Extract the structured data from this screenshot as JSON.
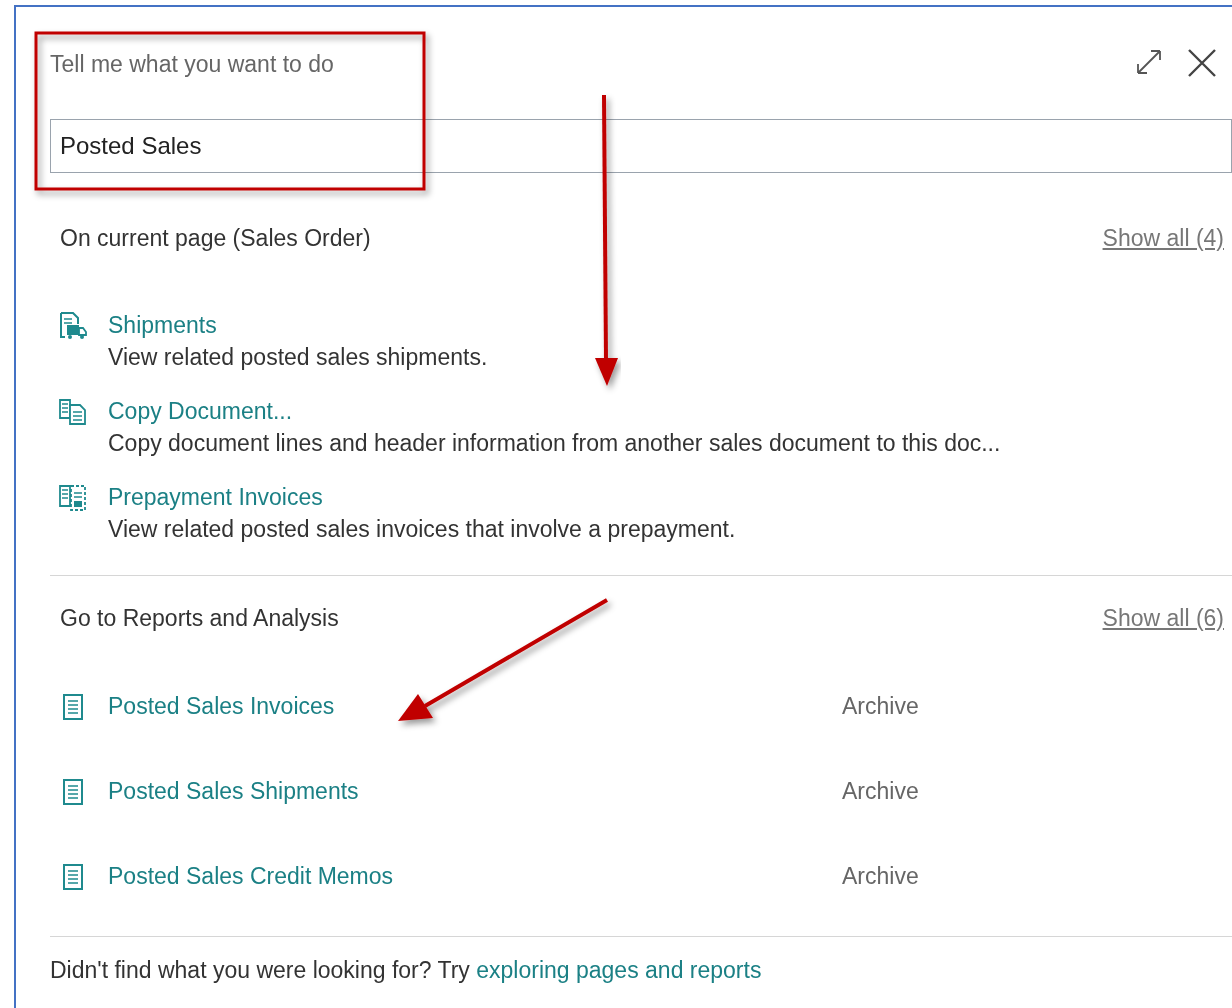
{
  "search": {
    "label": "Tell me what you want to do",
    "value": "Posted Sales"
  },
  "sections": [
    {
      "title": "On current page (Sales Order)",
      "show_all": "Show all (4)",
      "items": [
        {
          "kind": "action",
          "title": "Shipments",
          "description": "View related posted sales shipments."
        },
        {
          "kind": "action",
          "title": "Copy Document...",
          "description": "Copy document lines and header information from another sales document to this doc..."
        },
        {
          "kind": "action",
          "title": "Prepayment Invoices",
          "description": "View related posted sales invoices that involve a prepayment."
        }
      ]
    },
    {
      "title": "Go to Reports and Analysis",
      "show_all": "Show all (6)",
      "items": [
        {
          "kind": "report",
          "title": "Posted Sales Invoices",
          "category": "Archive"
        },
        {
          "kind": "report",
          "title": "Posted Sales Shipments",
          "category": "Archive"
        },
        {
          "kind": "report",
          "title": "Posted Sales Credit Memos",
          "category": "Archive"
        }
      ]
    }
  ],
  "footer": {
    "text": "Didn't find what you were looking for? Try",
    "link": "exploring pages and reports"
  }
}
